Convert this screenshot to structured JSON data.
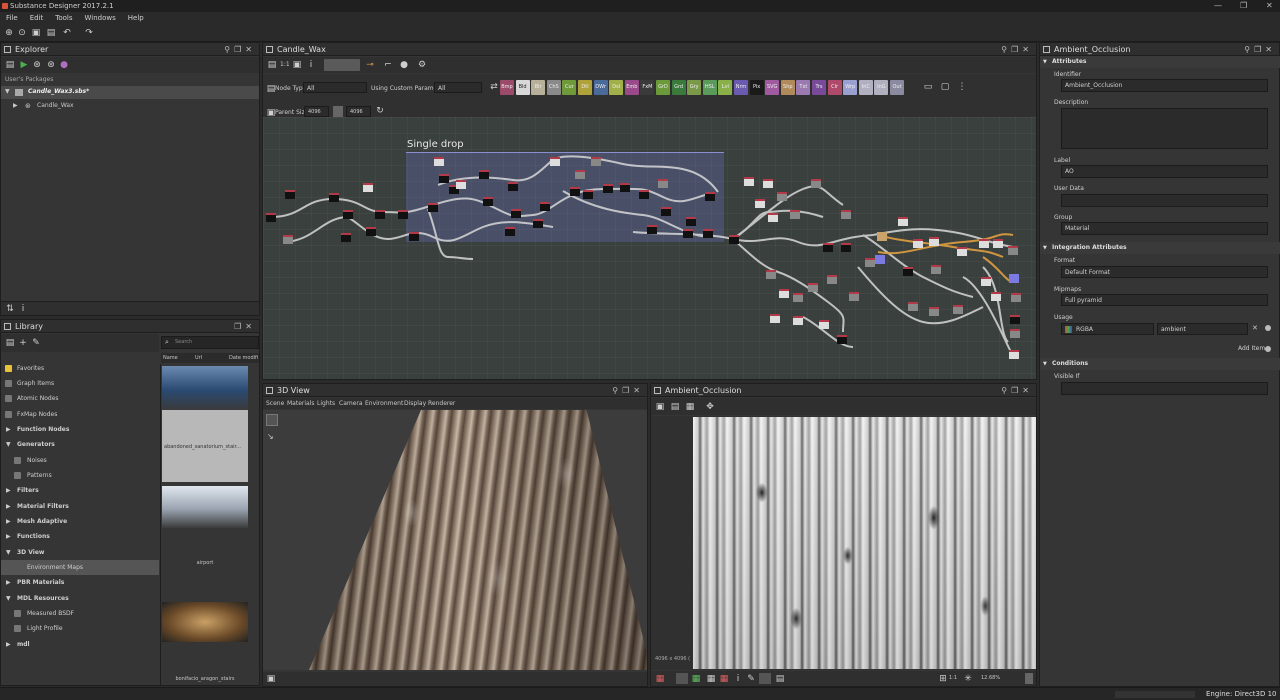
{
  "window": {
    "title": "Substance Designer 2017.2.1",
    "controls": [
      "—",
      "❐",
      "✕"
    ]
  },
  "menu": [
    "File",
    "Edit",
    "Tools",
    "Windows",
    "Help"
  ],
  "explorer": {
    "title": "Explorer",
    "section_label": "User's Packages",
    "package": "Candle_Wax3.sbs*",
    "graph": "Candle_Wax"
  },
  "library": {
    "title": "Library",
    "search_placeholder": "Search",
    "columns": [
      "Name",
      "Url",
      "Date modifi"
    ],
    "items": [
      {
        "label": "Favorites",
        "type": "leaf",
        "bold": false
      },
      {
        "label": "Graph Items",
        "type": "leaf",
        "bold": false
      },
      {
        "label": "Atomic Nodes",
        "type": "leaf",
        "bold": false
      },
      {
        "label": "FxMap Nodes",
        "type": "leaf",
        "bold": false
      },
      {
        "label": "Function Nodes",
        "type": "group",
        "bold": true
      },
      {
        "label": "Generators",
        "type": "group-open",
        "bold": true
      },
      {
        "label": "Noises",
        "type": "leaf",
        "bold": false
      },
      {
        "label": "Patterns",
        "type": "leaf",
        "bold": false
      },
      {
        "label": "Filters",
        "type": "group",
        "bold": true
      },
      {
        "label": "Material Filters",
        "type": "group",
        "bold": true
      },
      {
        "label": "Mesh Adaptive",
        "type": "group",
        "bold": true
      },
      {
        "label": "Functions",
        "type": "group",
        "bold": true
      },
      {
        "label": "3D View",
        "type": "group-open",
        "bold": true
      },
      {
        "label": "Environment Maps",
        "type": "selected",
        "bold": false
      },
      {
        "label": "PBR Materials",
        "type": "group",
        "bold": true
      },
      {
        "label": "MDL Resources",
        "type": "group-open",
        "bold": true
      },
      {
        "label": "Measured BSDF",
        "type": "leaf",
        "bold": false
      },
      {
        "label": "Light Profile",
        "type": "leaf",
        "bold": false
      },
      {
        "label": "mdl",
        "type": "group",
        "bold": true
      }
    ],
    "thumbnails": [
      "abandoned_sanatorium_stair...",
      "airport",
      "bonifacio_aragon_stairs"
    ]
  },
  "graph": {
    "title": "Candle_Wax",
    "zoom_label": "1:1",
    "node_type_label": "Node Type",
    "node_type_value": "All",
    "custom_params_label": "Using Custom Parameters",
    "custom_params_value": "All",
    "parent_size_label": "Parent Size:",
    "parent_size_w": "4096",
    "parent_size_h": "4096",
    "frame_label": "Single drop",
    "filters": [
      {
        "label": "Bmp",
        "color": "#9b4a6a"
      },
      {
        "label": "Bld",
        "color": "#d8d8d8"
      },
      {
        "label": "Blr",
        "color": "#b9b09a"
      },
      {
        "label": "ChS",
        "color": "#8a8a8a"
      },
      {
        "label": "Cur",
        "color": "#6f9a3a"
      },
      {
        "label": "Dtl",
        "color": "#b0a23a"
      },
      {
        "label": "DWr",
        "color": "#4a6a9a"
      },
      {
        "label": "Dsl",
        "color": "#a2b04a"
      },
      {
        "label": "Emb",
        "color": "#9a4a8a"
      },
      {
        "label": "FxM",
        "color": "#3a3a3a"
      },
      {
        "label": "GrD",
        "color": "#6a9a3a"
      },
      {
        "label": "Grd",
        "color": "#3a7a3a"
      },
      {
        "label": "Gry",
        "color": "#7a9a4a"
      },
      {
        "label": "HSL",
        "color": "#5a9a5a"
      },
      {
        "label": "Lvl",
        "color": "#8ab04a"
      },
      {
        "label": "Nrm",
        "color": "#6a5ab0"
      },
      {
        "label": "Pix",
        "color": "#1a1a1a"
      },
      {
        "label": "SVG",
        "color": "#a05aa0"
      },
      {
        "label": "Shp",
        "color": "#b08a5a"
      },
      {
        "label": "Txt",
        "color": "#9a7ab0"
      },
      {
        "label": "Trs",
        "color": "#7a4a9a"
      },
      {
        "label": "Clr",
        "color": "#b04a6a"
      },
      {
        "label": "Wrp",
        "color": "#9aa0d0"
      },
      {
        "label": "InC",
        "color": "#b0b0c0"
      },
      {
        "label": "InG",
        "color": "#b0b0c0"
      },
      {
        "label": "Out",
        "color": "#8a8aa0"
      }
    ]
  },
  "view3d": {
    "title": "3D View",
    "menu": [
      "Scene",
      "Materials",
      "Lights",
      "Camera",
      "Environment",
      "Display",
      "Renderer"
    ]
  },
  "view2d": {
    "title": "Ambient_Occlusion",
    "resolution": "4096 x 4096 (",
    "ratio": "1:1",
    "zoom": "12.68%"
  },
  "properties": {
    "title": "Ambient_Occlusion",
    "attributes_header": "Attributes",
    "identifier_label": "Identifier",
    "identifier_value": "Ambient_Occlusion",
    "description_label": "Description",
    "label_label": "Label",
    "label_value": "AO",
    "userdata_label": "User Data",
    "group_label": "Group",
    "group_value": "Material",
    "integration_header": "Integration Attributes",
    "format_label": "Format",
    "format_value": "Default Format",
    "mipmaps_label": "Mipmaps",
    "mipmaps_value": "Full pyramid",
    "usage_label": "Usage",
    "usage_channel": "RGBA",
    "usage_value": "ambient",
    "add_item": "Add Item",
    "conditions_header": "Conditions",
    "visible_if_label": "Visible If"
  },
  "status": {
    "engine": "Engine: Direct3D 10"
  }
}
